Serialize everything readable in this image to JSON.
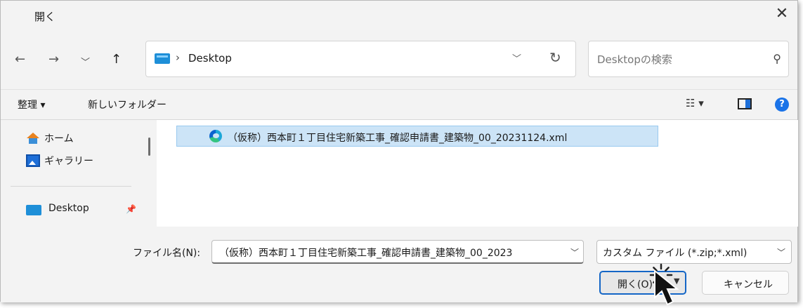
{
  "title": "開く",
  "nav": {
    "back_icon": "arrow-left-icon",
    "forward_icon": "arrow-right-icon",
    "recent_icon": "chevron-down-icon",
    "up_icon": "arrow-up-icon"
  },
  "address": {
    "separator": "›",
    "crumb": "Desktop"
  },
  "search": {
    "placeholder": "Desktopの検索"
  },
  "toolbar": {
    "organize": "整理 ▾",
    "new_folder": "新しいフォルダー"
  },
  "sidebar": {
    "items": [
      {
        "label": "ホーム",
        "icon": "home-icon"
      },
      {
        "label": "ギャラリー",
        "icon": "gallery-icon"
      },
      {
        "label": "Desktop",
        "icon": "desktop-folder-icon"
      }
    ]
  },
  "files": [
    {
      "name": "（仮称）西本町１丁目住宅新築工事_確認申請書_建築物_00_20231124.xml",
      "icon": "edge-file-icon",
      "selected": true
    }
  ],
  "bottom": {
    "filename_label": "ファイル名(N):",
    "filename_value": "（仮称）西本町１丁目住宅新築工事_確認申請書_建築物_00_2023",
    "filetype": "カスタム ファイル (*.zip;*.xml)",
    "open_button": "開く(O)",
    "cancel_button": "キャンセル"
  },
  "colors": {
    "accent": "#1466c6",
    "selection": "#cce4f7",
    "background": "#f3f3f3"
  }
}
